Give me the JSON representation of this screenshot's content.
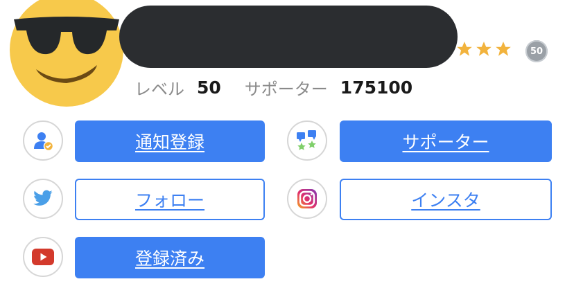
{
  "profile": {
    "avatar_icon": "sunglasses-emoji-icon",
    "name_redacted": true,
    "rank_stars": 3,
    "level_badge": "50",
    "level_label": "レベル",
    "level_value": "50",
    "supporter_label": "サポーター",
    "supporter_value": "175100"
  },
  "actions": {
    "notify": {
      "icon": "person-check-icon",
      "label": "通知登録"
    },
    "supporter": {
      "icon": "supporter-stars-icon",
      "label": "サポーター"
    },
    "twitter": {
      "icon": "twitter-bird-icon",
      "label": "フォロー"
    },
    "instagram": {
      "icon": "instagram-icon",
      "label": "インスタ"
    },
    "youtube": {
      "icon": "youtube-icon",
      "label": "登録済み"
    }
  },
  "colors": {
    "button_blue": "#3d80f2",
    "star_gold": "#f2b33d",
    "name_bar": "#2b2d30"
  }
}
